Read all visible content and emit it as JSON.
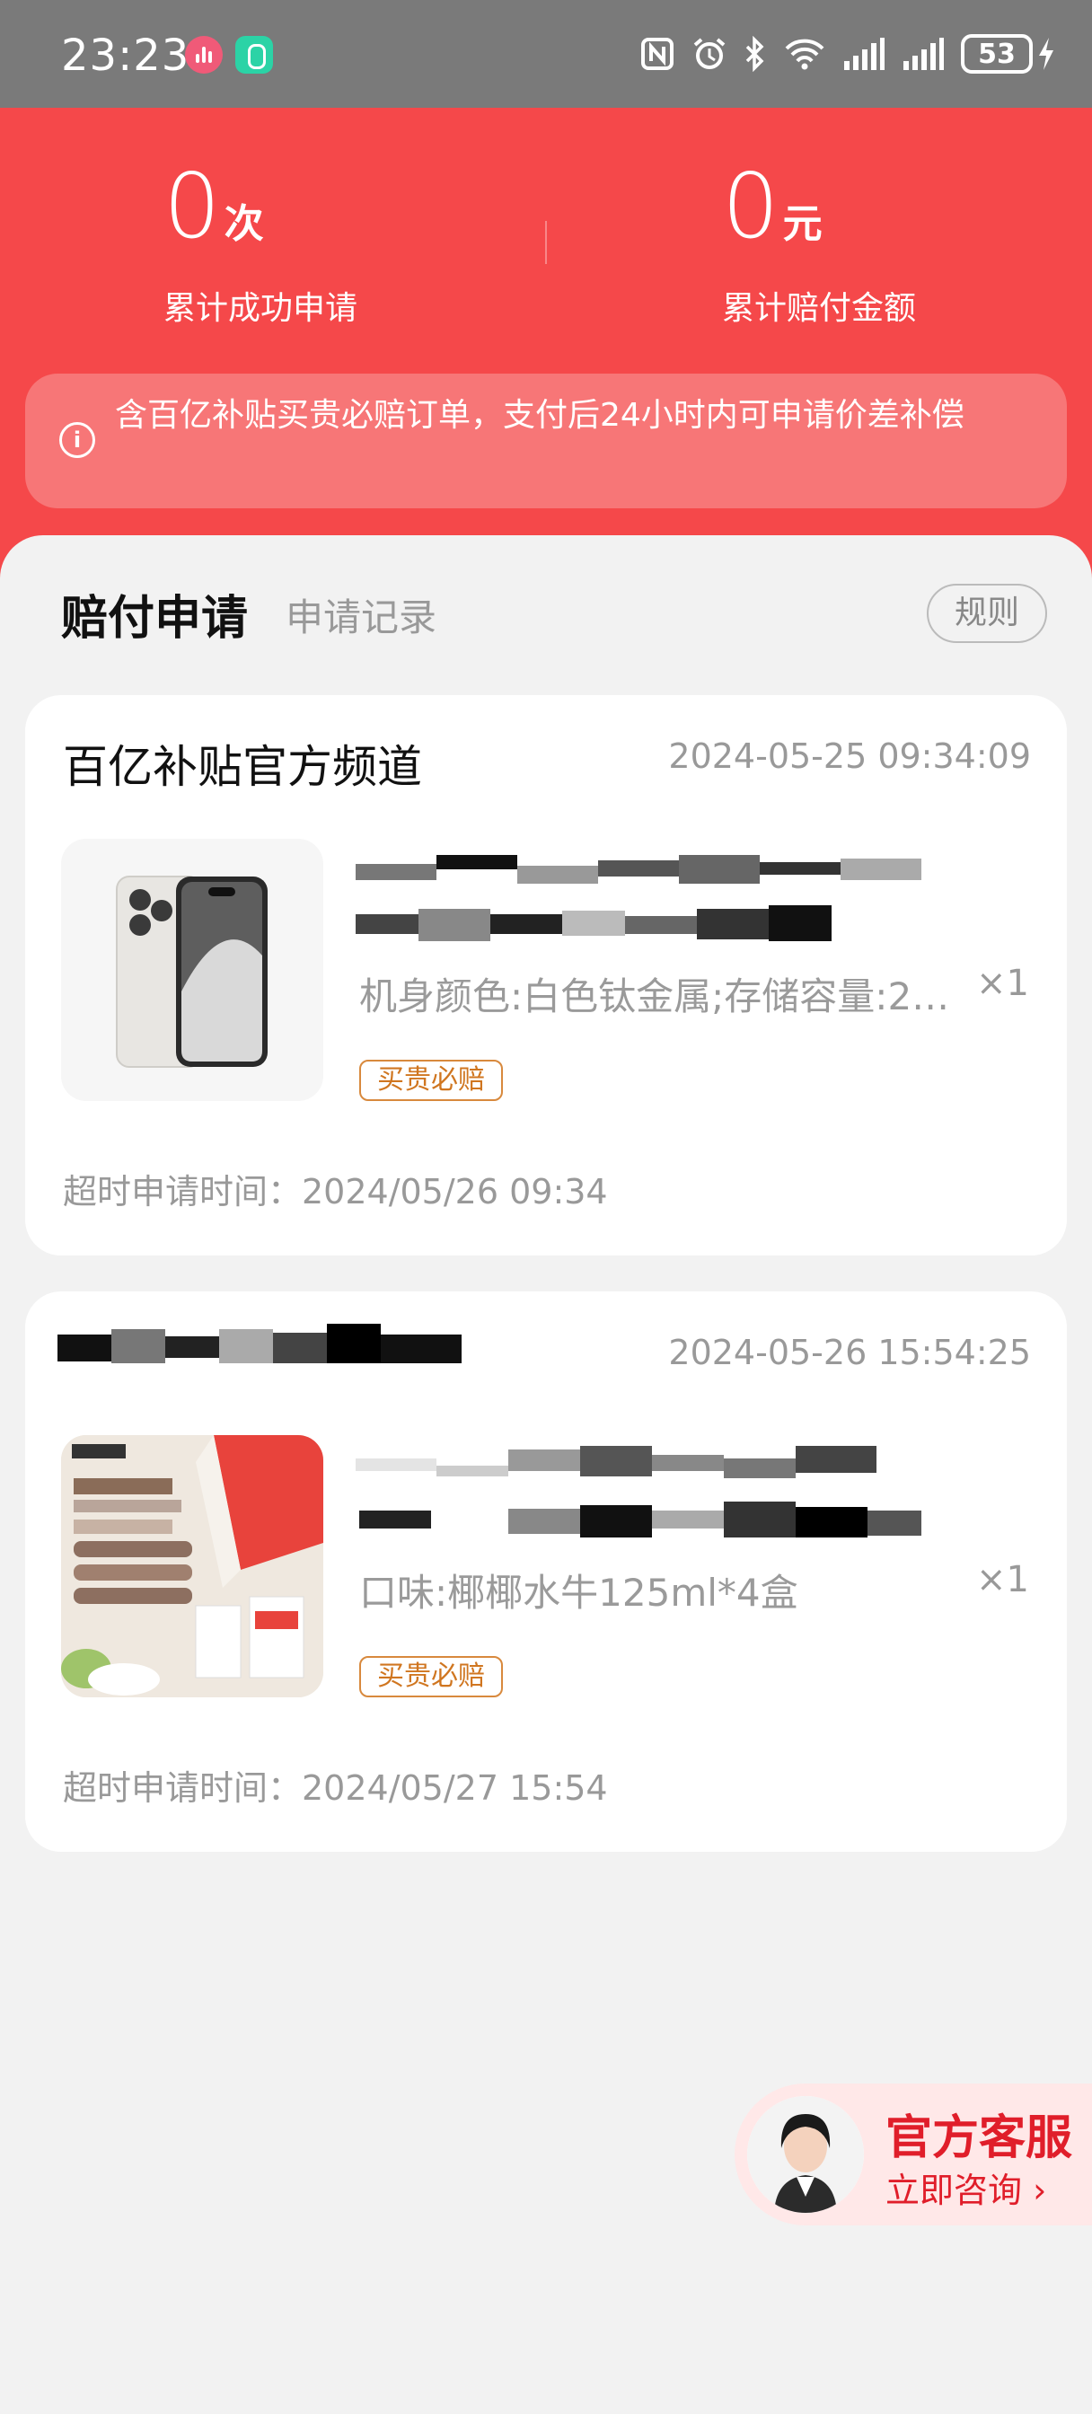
{
  "status_bar": {
    "time": "23:23",
    "battery": "53",
    "icons": [
      "nfc-icon",
      "alarm-icon",
      "bluetooth-icon",
      "wifi-icon",
      "signal-icon",
      "signal-icon",
      "battery-icon",
      "charging-icon"
    ]
  },
  "stats": {
    "success_count": "0",
    "success_unit": "次",
    "success_label": "累计成功申请",
    "amount": "0",
    "amount_unit": "元",
    "amount_label": "累计赔付金额"
  },
  "notice": {
    "icon": "info-icon",
    "text": "含百亿补贴买贵必赔订单，支付后24小时内可申请价差补偿"
  },
  "tabs": {
    "active": "赔付申请",
    "inactive": "申请记录",
    "rules": "规则"
  },
  "orders": [
    {
      "shop": "百亿补贴官方频道",
      "time": "2024-05-25 09:34:09",
      "spec": "机身颜色:白色钛金属;存储容量:2…",
      "qty": "×1",
      "badge": "买贵必赔",
      "deadline": "超时申请时间：2024/05/26 09:34"
    },
    {
      "shop": "",
      "time": "2024-05-26 15:54:25",
      "spec": "口味:椰椰水牛125ml*4盒",
      "qty": "×1",
      "badge": "买贵必赔",
      "deadline": "超时申请时间：2024/05/27 15:54"
    }
  ],
  "customer_service": {
    "title": "官方客服",
    "subtitle": "立即咨询 ›"
  },
  "colors": {
    "header_red": "#f5484a",
    "accent_pink": "#e8254f",
    "badge_orange": "#d07620",
    "cs_red": "#e01e2a"
  }
}
